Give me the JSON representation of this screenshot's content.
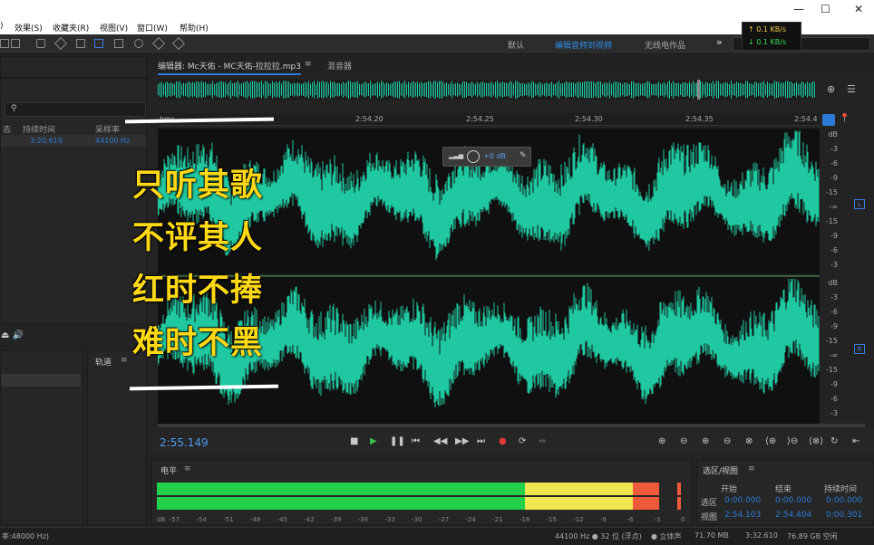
{
  "menu": {
    "items": [
      ")",
      "效果(S)",
      "收藏夹(R)",
      "视图(V)",
      "窗口(W)",
      "帮助(H)"
    ]
  },
  "window_controls": {
    "minimize": "—",
    "maximize": "☐",
    "close": "✕"
  },
  "workspaces": {
    "items": [
      "默认",
      "编辑音频到视频",
      "无线电作品"
    ],
    "active_index": 1,
    "more": "»"
  },
  "network": {
    "up": "↑ 0.1 KB/s",
    "down": "↓ 0.1 KB/s",
    "up_color": "#f5c842",
    "down_color": "#33dd55"
  },
  "files": {
    "col_state": "态",
    "col_duration": "持续时间",
    "col_rate": "采样率",
    "row_duration": "3:20.619",
    "row_rate": "44100 Hz"
  },
  "tracks": {
    "label": "轨道"
  },
  "editor": {
    "tab_editor": "编辑器: Mc天佑 - MC天佑-拉拉拉.mp3",
    "tab_mixer": "混音器",
    "ruler_start": "hms",
    "ruler_ticks": [
      "2:54.20",
      "2:54.25",
      "2:54.30",
      "2:54.35",
      "2:54.4"
    ],
    "hud_gain": "+0 dB",
    "current_time": "2:55.149",
    "waveform_color": "#1fc8a0"
  },
  "channels": {
    "db_labels": [
      "dB",
      "-3",
      "-6",
      "-9",
      "-15",
      "-∞",
      "-15",
      "-9",
      "-6",
      "-3"
    ],
    "left": "L",
    "right": "R"
  },
  "overlay_text": {
    "lines": [
      "只听其歌",
      "不评其人",
      "红时不捧",
      "难时不黑"
    ]
  },
  "levels": {
    "title": "电平",
    "scale": [
      "dB",
      "-57",
      "-54",
      "-51",
      "-48",
      "-45",
      "-42",
      "-39",
      "-36",
      "-33",
      "-30",
      "-27",
      "-24",
      "-21",
      "-18",
      "-15",
      "-12",
      "-9",
      "-6",
      "-3",
      "0"
    ],
    "green_until": -18,
    "yellow_until": -6,
    "red_until": -3,
    "peak": -1
  },
  "selection": {
    "title": "选区/视图",
    "col_start": "开始",
    "col_end": "结束",
    "col_duration": "持续时间",
    "row_sel": "选区",
    "row_view": "视图",
    "sel_start": "0:00.000",
    "sel_end": "0:00.000",
    "sel_duration": "0:00.000",
    "view_start": "2:54.103",
    "view_end": "2:54.404",
    "view_duration": "0:00.301"
  },
  "status": {
    "left_text": "率:48000 Hz)",
    "format": "44100 Hz ● 32 位 (浮点)",
    "channels": "● 立体声",
    "size": "71.70 MB",
    "duration": "3:32.610",
    "free": "76.89 GB 空闲"
  }
}
